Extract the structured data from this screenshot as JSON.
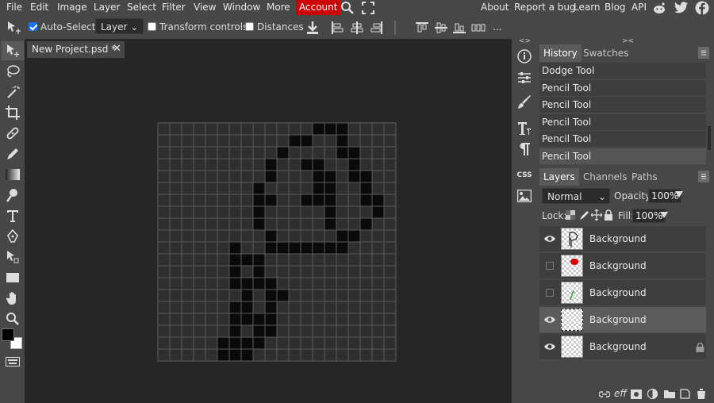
{
  "menubar": {
    "items": [
      "File",
      "Edit",
      "Image",
      "Layer",
      "Select",
      "Filter",
      "View",
      "Window",
      "More"
    ],
    "account": "Account",
    "right_links": [
      "About",
      "Report a bug",
      "Learn",
      "Blog",
      "API"
    ]
  },
  "toolbar": {
    "auto_select_label": "Auto-Select",
    "auto_select_checked": true,
    "select_mode": "Layer",
    "transform_label": "Transform controls",
    "distances_label": "Distances",
    "more": "..."
  },
  "document": {
    "tab_title": "New Project.psd *",
    "grid": {
      "cols": 20,
      "rows": 20
    }
  },
  "drawing_cells": [
    [
      13,
      0
    ],
    [
      14,
      0
    ],
    [
      15,
      0
    ],
    [
      11,
      1
    ],
    [
      12,
      1
    ],
    [
      15,
      1
    ],
    [
      10,
      2
    ],
    [
      15,
      2
    ],
    [
      16,
      2
    ],
    [
      9,
      3
    ],
    [
      12,
      3
    ],
    [
      13,
      3
    ],
    [
      16,
      3
    ],
    [
      9,
      4
    ],
    [
      13,
      4
    ],
    [
      14,
      4
    ],
    [
      16,
      4
    ],
    [
      17,
      4
    ],
    [
      8,
      5
    ],
    [
      13,
      5
    ],
    [
      14,
      5
    ],
    [
      17,
      5
    ],
    [
      8,
      6
    ],
    [
      9,
      6
    ],
    [
      12,
      6
    ],
    [
      13,
      6
    ],
    [
      14,
      6
    ],
    [
      17,
      6
    ],
    [
      18,
      6
    ],
    [
      8,
      7
    ],
    [
      14,
      7
    ],
    [
      18,
      7
    ],
    [
      8,
      8
    ],
    [
      14,
      8
    ],
    [
      17,
      8
    ],
    [
      9,
      9
    ],
    [
      15,
      9
    ],
    [
      16,
      9
    ],
    [
      6,
      10
    ],
    [
      9,
      10
    ],
    [
      10,
      10
    ],
    [
      11,
      10
    ],
    [
      12,
      10
    ],
    [
      13,
      10
    ],
    [
      14,
      10
    ],
    [
      15,
      10
    ],
    [
      6,
      11
    ],
    [
      7,
      11
    ],
    [
      8,
      11
    ],
    [
      6,
      12
    ],
    [
      8,
      12
    ],
    [
      6,
      13
    ],
    [
      7,
      13
    ],
    [
      8,
      13
    ],
    [
      9,
      13
    ],
    [
      7,
      14
    ],
    [
      9,
      14
    ],
    [
      10,
      14
    ],
    [
      6,
      15
    ],
    [
      7,
      15
    ],
    [
      9,
      15
    ],
    [
      6,
      16
    ],
    [
      7,
      16
    ],
    [
      8,
      16
    ],
    [
      9,
      16
    ],
    [
      6,
      17
    ],
    [
      8,
      17
    ],
    [
      9,
      17
    ],
    [
      5,
      18
    ],
    [
      6,
      18
    ],
    [
      7,
      18
    ],
    [
      8,
      18
    ],
    [
      5,
      19
    ],
    [
      6,
      19
    ],
    [
      7,
      19
    ]
  ],
  "history": {
    "tabs": [
      "History",
      "Swatches"
    ],
    "items": [
      "Dodge Tool",
      "Pencil Tool",
      "Pencil Tool",
      "Pencil Tool",
      "Pencil Tool",
      "Pencil Tool"
    ]
  },
  "layers_panel": {
    "tabs": [
      "Layers",
      "Channels",
      "Paths"
    ],
    "blend_mode": "Normal",
    "opacity_label": "Opacity:",
    "opacity": "100%",
    "lock_label": "Lock:",
    "fill_label": "Fill:",
    "fill": "100%",
    "layers": [
      {
        "name": "Background",
        "visible": true,
        "selected": false,
        "locked": false
      },
      {
        "name": "Background",
        "visible": false,
        "selected": false,
        "locked": false
      },
      {
        "name": "Background",
        "visible": false,
        "selected": false,
        "locked": false
      },
      {
        "name": "Background",
        "visible": true,
        "selected": true,
        "locked": false
      },
      {
        "name": "Background",
        "visible": true,
        "selected": false,
        "locked": true
      }
    ],
    "footer_eff": "eff"
  },
  "colors": {
    "accent": "#cc0000",
    "checkbox": "#1a73e8",
    "foreground": "#000000",
    "background": "#ffffff"
  }
}
